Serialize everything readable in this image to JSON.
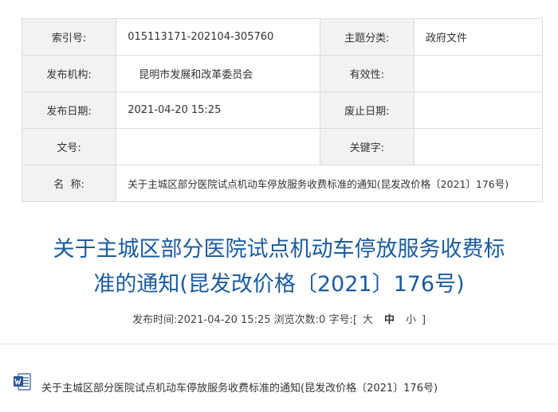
{
  "meta": {
    "index_label": "索引号:",
    "index_value": "015113171-202104-305760",
    "topic_label": "主题分类:",
    "topic_value": "政府文件",
    "publisher_label": "发布机构:",
    "publisher_value": "昆明市发展和改革委员会",
    "validity_label": "有效性:",
    "validity_value": "",
    "pubdate_label": "发布日期:",
    "pubdate_value": "2021-04-20 15:25",
    "expiry_label": "废止日期:",
    "expiry_value": "",
    "docno_label": "文号:",
    "docno_value": "",
    "keywords_label": "关键字:",
    "keywords_value": "",
    "name_label": "名  称:",
    "name_value": "关于主城区部分医院试点机动车停放服务收费标准的通知(昆发改价格〔2021〕176号)"
  },
  "article": {
    "title_line1": "关于主城区部分医院试点机动车停放服务收费标",
    "title_line2": "准的通知(昆发改价格〔2021〕176号)",
    "publish_time_label": "发布时间:",
    "publish_time": "2021-04-20 15:25",
    "views_label": "浏览次数:",
    "views": "0",
    "font_size_label": "字号:",
    "bracket_open": "[",
    "size_large": "大",
    "size_medium": "中",
    "size_small": "小",
    "bracket_close": "]"
  },
  "attachment": {
    "icon": "word-doc-icon",
    "label": "关于主城区部分医院试点机动车停放服务收费标准的通知(昆发改价格〔2021〕176号)"
  },
  "colors": {
    "title": "#1a5ba3",
    "label_bg": "#f2f2f2",
    "border": "#dcdcdc",
    "word_icon": "#2b579a"
  }
}
